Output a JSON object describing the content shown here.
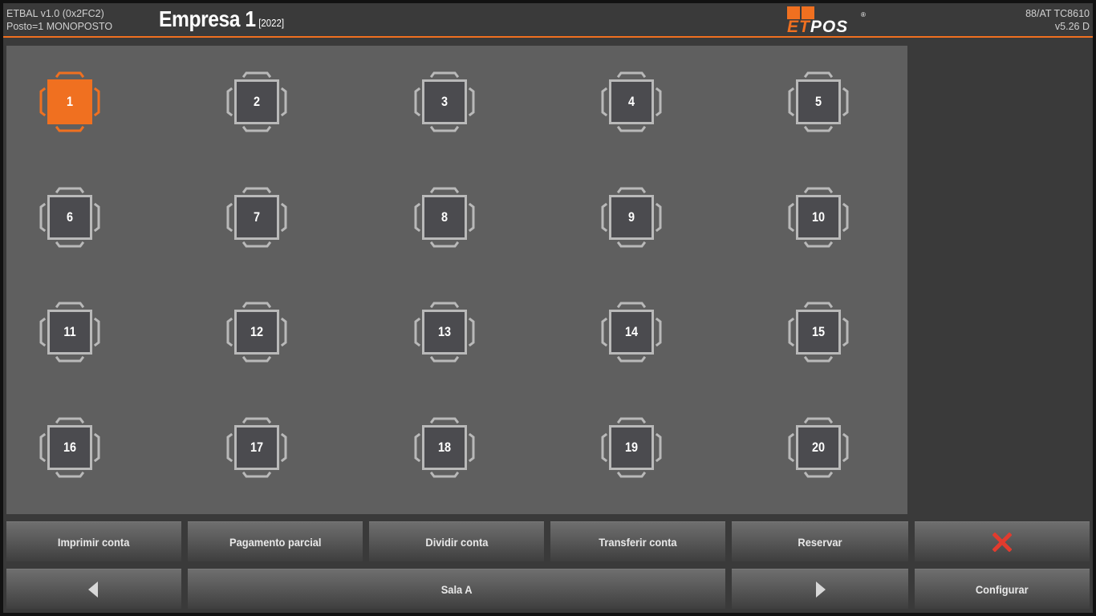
{
  "header": {
    "app_name": "ETBAL v1.0 (0x2FC2)",
    "station": "Posto=1 MONOPOSTO",
    "company": "Empresa 1",
    "year": "[2022]",
    "logo_et": "ET",
    "logo_pos": "POS",
    "logo_reg": "®",
    "device": "88/AT TC8610",
    "version": "v5.26 D"
  },
  "colors": {
    "accent": "#f07020",
    "floor": "#5f5f5f",
    "table_fill": "#4b4b4f",
    "chair": "#b9b9b9",
    "selected": "#f07020"
  },
  "tables": [
    {
      "number": "1",
      "selected": true
    },
    {
      "number": "2",
      "selected": false
    },
    {
      "number": "3",
      "selected": false
    },
    {
      "number": "4",
      "selected": false
    },
    {
      "number": "5",
      "selected": false
    },
    {
      "number": "6",
      "selected": false
    },
    {
      "number": "7",
      "selected": false
    },
    {
      "number": "8",
      "selected": false
    },
    {
      "number": "9",
      "selected": false
    },
    {
      "number": "10",
      "selected": false
    },
    {
      "number": "11",
      "selected": false
    },
    {
      "number": "12",
      "selected": false
    },
    {
      "number": "13",
      "selected": false
    },
    {
      "number": "14",
      "selected": false
    },
    {
      "number": "15",
      "selected": false
    },
    {
      "number": "16",
      "selected": false
    },
    {
      "number": "17",
      "selected": false
    },
    {
      "number": "18",
      "selected": false
    },
    {
      "number": "19",
      "selected": false
    },
    {
      "number": "20",
      "selected": false
    }
  ],
  "actions": {
    "print_bill": "Imprimir conta",
    "partial_payment": "Pagamento parcial",
    "split_bill": "Dividir conta",
    "transfer_bill": "Transferir conta",
    "reserve": "Reservar",
    "close_icon": "close-x-icon",
    "prev_icon": "triangle-left-icon",
    "room": "Sala A",
    "next_icon": "triangle-right-icon",
    "configure": "Configurar"
  }
}
